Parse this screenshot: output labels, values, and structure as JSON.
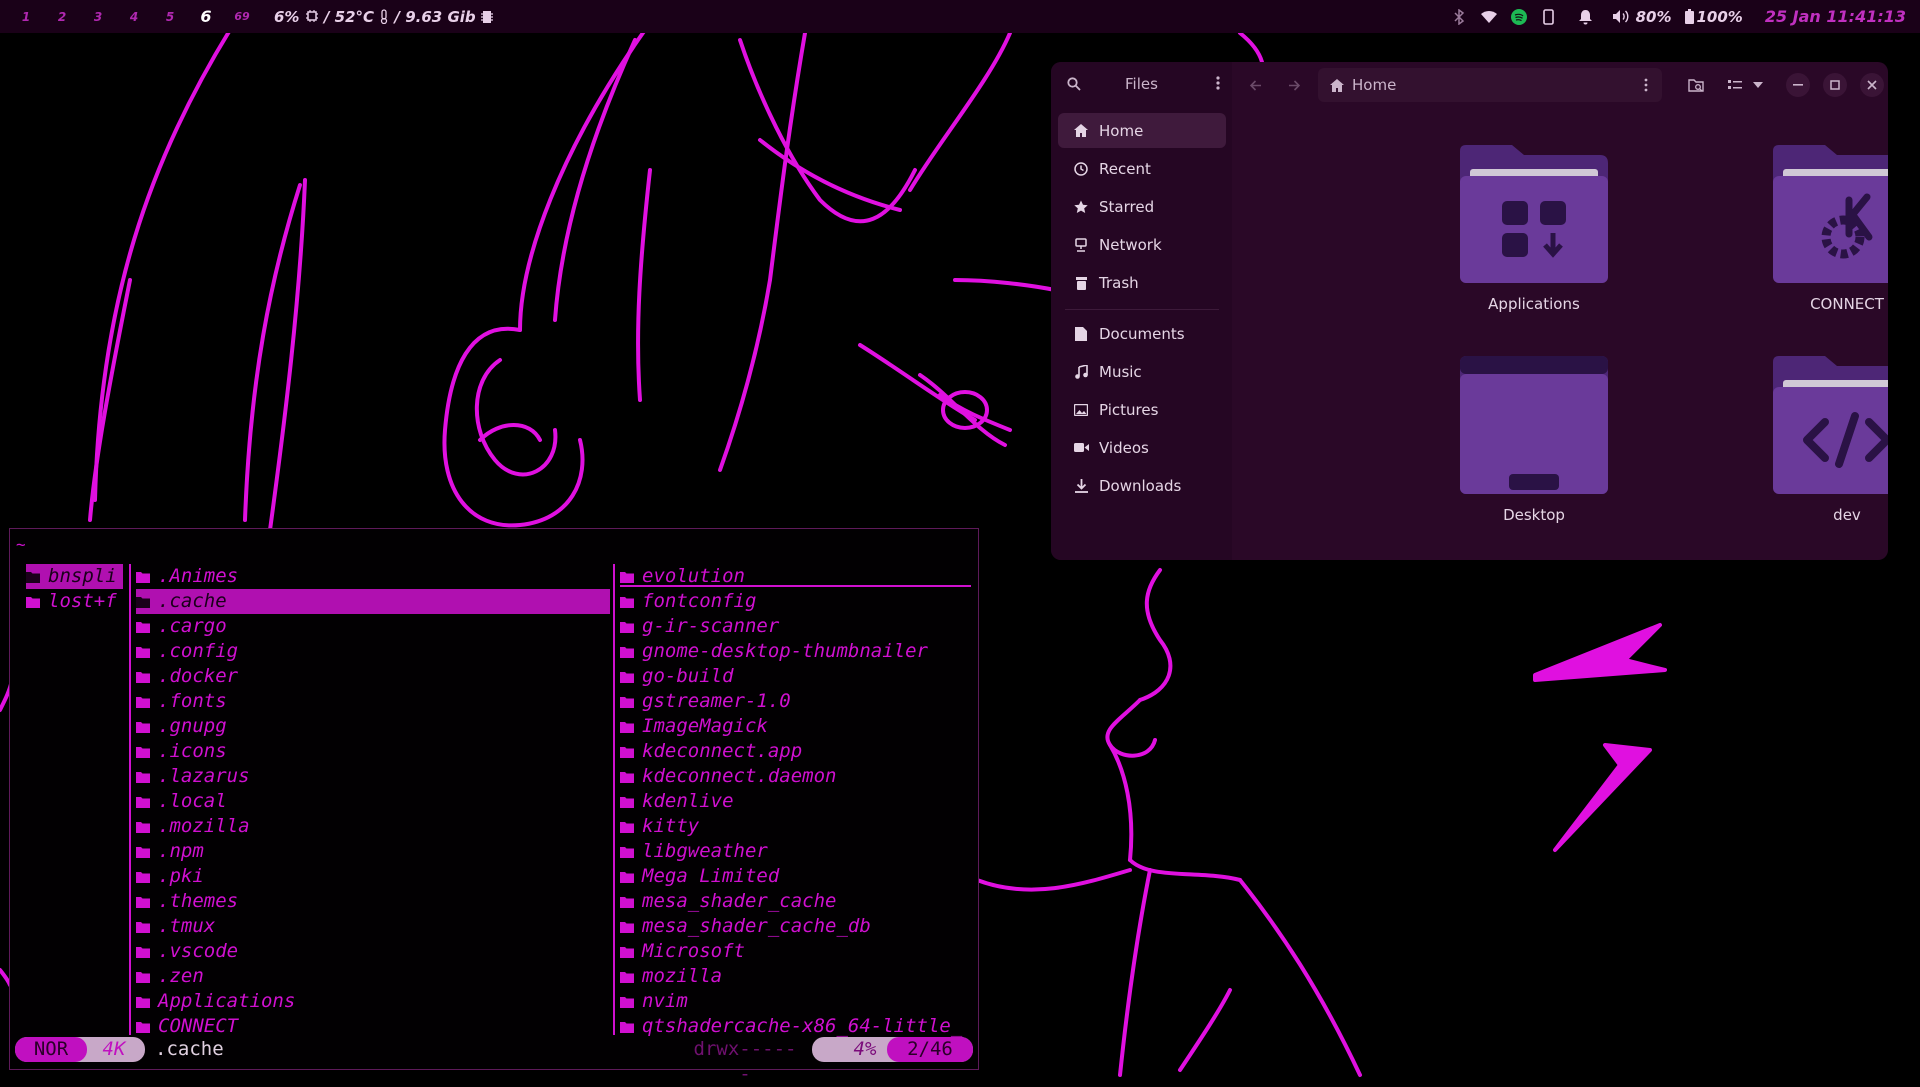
{
  "topbar": {
    "workspaces": [
      "1",
      "2",
      "3",
      "4",
      "5",
      "6",
      "69"
    ],
    "active_workspace": "6",
    "cpu": "6%",
    "temp": "52°C",
    "mem": "9.63 Gib",
    "volume": "80%",
    "battery": "100%",
    "date": "25 Jan",
    "time": "11:41:13",
    "tray_icons": [
      "bluetooth-icon",
      "wifi-icon",
      "spotify-icon",
      "phone-icon",
      "notification-icon",
      "volume-icon",
      "battery-icon"
    ]
  },
  "files": {
    "title": "Files",
    "path": "Home",
    "sidebar": {
      "places": [
        "Home",
        "Recent",
        "Starred",
        "Network",
        "Trash"
      ],
      "bookmarks": [
        "Documents",
        "Music",
        "Pictures",
        "Videos",
        "Downloads"
      ]
    },
    "folders": [
      "Applications",
      "CONNECT",
      "Desktop",
      "dev"
    ]
  },
  "terminal": {
    "cwd": "~",
    "parent_column": [
      "bnspli",
      "lost+f"
    ],
    "current_column": [
      ".Animes",
      ".cache",
      ".cargo",
      ".config",
      ".docker",
      ".fonts",
      ".gnupg",
      ".icons",
      ".lazarus",
      ".local",
      ".mozilla",
      ".npm",
      ".pki",
      ".themes",
      ".tmux",
      ".vscode",
      ".zen",
      "Applications",
      "CONNECT"
    ],
    "selected": ".cache",
    "preview_column": [
      "evolution",
      "fontconfig",
      "g-ir-scanner",
      "gnome-desktop-thumbnailer",
      "go-build",
      "gstreamer-1.0",
      "ImageMagick",
      "kdeconnect.app",
      "kdeconnect.daemon",
      "kdenlive",
      "kitty",
      "libgweather",
      "Mega Limited",
      "mesa_shader_cache",
      "mesa_shader_cache_db",
      "Microsoft",
      "mozilla",
      "nvim",
      "qtshadercache-x86_64-little_"
    ],
    "status": {
      "mode": "NOR",
      "size": "4K",
      "file": ".cache",
      "perms": "drwx------",
      "percent": "4%",
      "position": "2/46"
    }
  },
  "colors": {
    "accent": "#d010d0",
    "bar_bg": "#1a0118",
    "files_bg": "#2a0827",
    "folder": "#6a3a9a"
  }
}
